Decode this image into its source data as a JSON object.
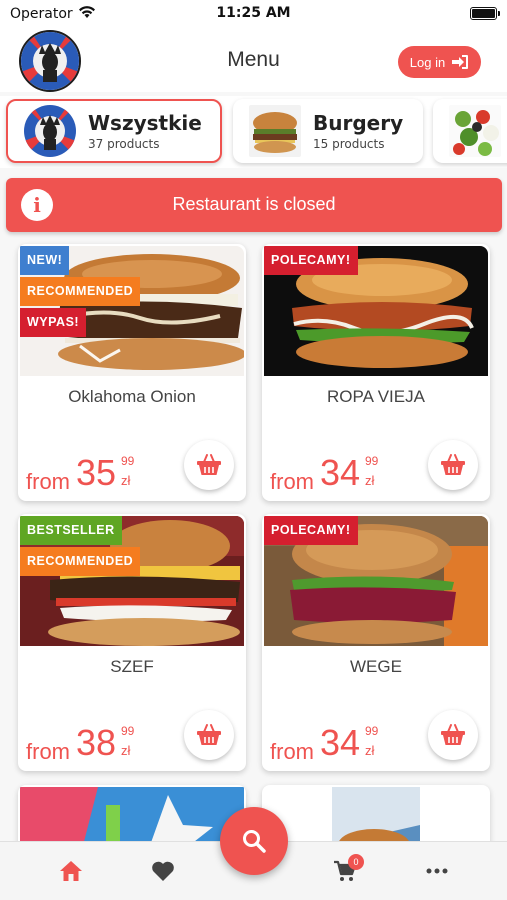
{
  "status_bar": {
    "carrier": "Operator",
    "time": "11:25 AM"
  },
  "header": {
    "title": "Menu",
    "login_label": "Log in"
  },
  "categories": [
    {
      "name": "Wszystkie",
      "count": "37 products",
      "active": true
    },
    {
      "name": "Burgery",
      "count": "15 products",
      "active": false
    },
    {
      "name": "",
      "count": "",
      "active": false
    }
  ],
  "banner": {
    "text": "Restaurant is closed",
    "icon": "info-icon"
  },
  "products": [
    {
      "name": "Oklahoma Onion",
      "badges": [
        {
          "label": "NEW!",
          "color": "#3f7fcf"
        },
        {
          "label": "RECOMMENDED",
          "color": "#f57c1f"
        },
        {
          "label": "WYPAS!",
          "color": "#d51f2f"
        }
      ],
      "price_from": "from",
      "price_main": "35",
      "price_cents": "99",
      "currency": "zł"
    },
    {
      "name": "ROPA VIEJA",
      "badges": [
        {
          "label": "POLECAMY!",
          "color": "#d51f2f"
        }
      ],
      "price_from": "from",
      "price_main": "34",
      "price_cents": "99",
      "currency": "zł"
    },
    {
      "name": "SZEF",
      "badges": [
        {
          "label": "BESTSELLER",
          "color": "#5fa623"
        },
        {
          "label": "RECOMMENDED",
          "color": "#f57c1f"
        }
      ],
      "price_from": "from",
      "price_main": "38",
      "price_cents": "99",
      "currency": "zł"
    },
    {
      "name": "WEGE",
      "badges": [
        {
          "label": "POLECAMY!",
          "color": "#d51f2f"
        }
      ],
      "price_from": "from",
      "price_main": "34",
      "price_cents": "99",
      "currency": "zł"
    }
  ],
  "bottom_nav": {
    "items": [
      "home-icon",
      "heart-icon",
      "search-icon",
      "cart-icon",
      "more-icon"
    ],
    "cart_count": "0"
  },
  "colors": {
    "accent": "#ef5350",
    "text": "#333333",
    "background": "#f7f7f7"
  }
}
